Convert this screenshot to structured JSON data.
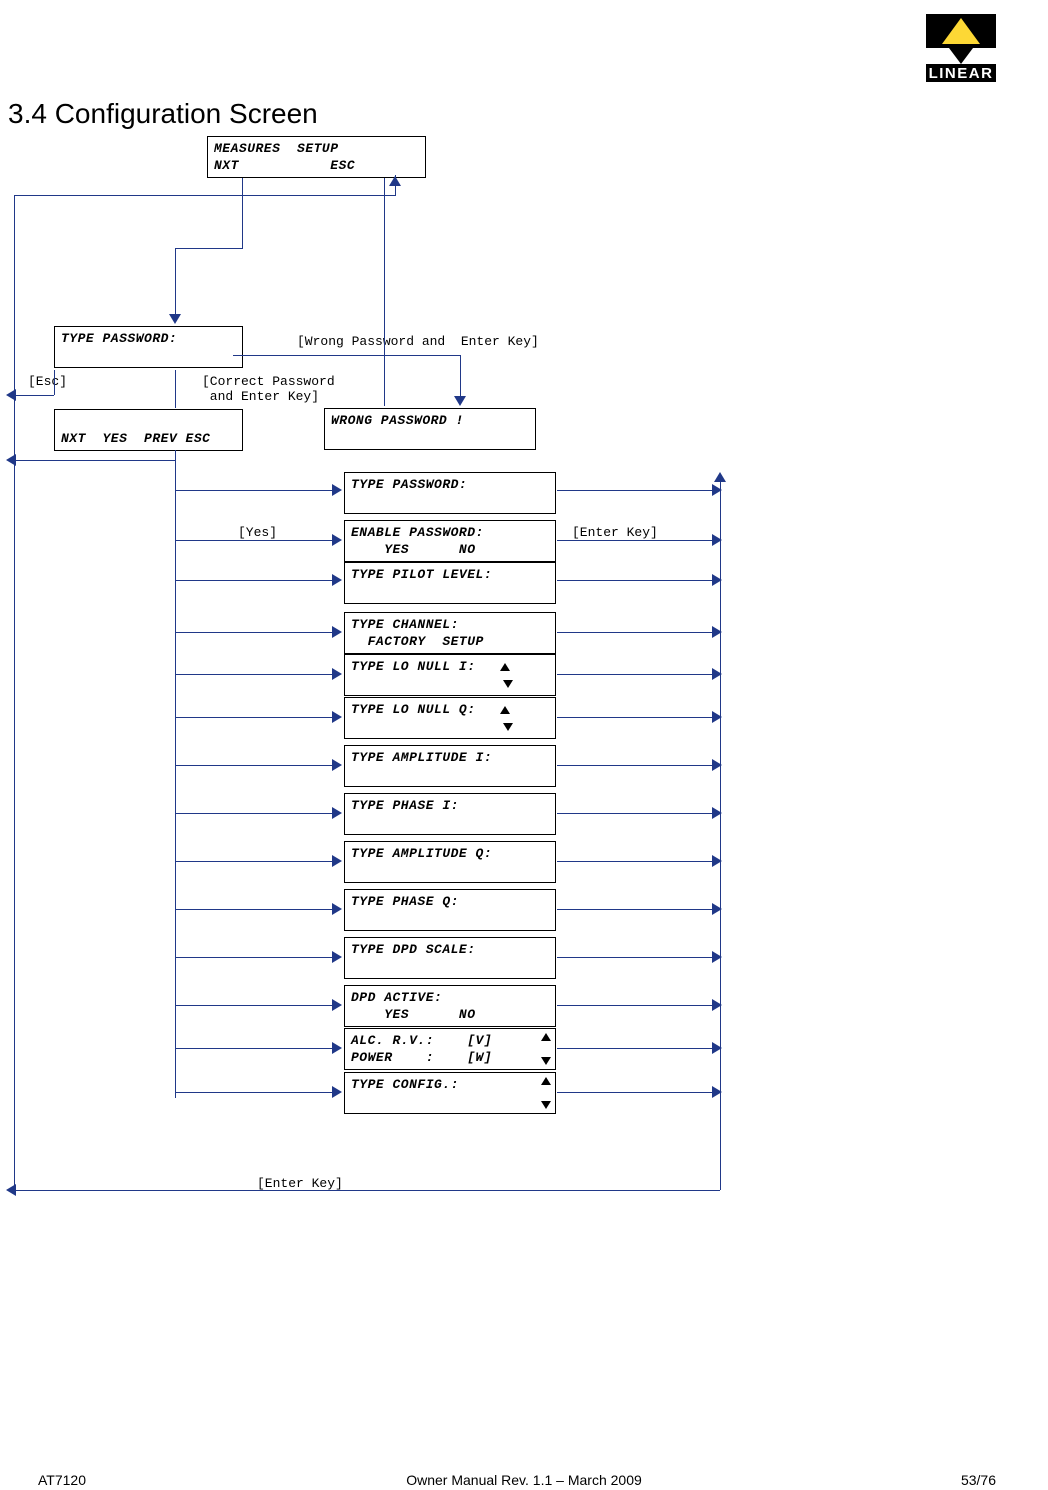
{
  "logo_text": "LINEAR",
  "heading": "3.4 Configuration Screen",
  "boxes": {
    "measures_setup": "MEASURES  SETUP\nNXT           ESC",
    "type_password_top": "TYPE PASSWORD:\n ",
    "nxt_yes_prev_esc": "\nNXT  YES  PREV ESC",
    "wrong_password": "WRONG PASSWORD !\n ",
    "type_password": "TYPE PASSWORD:\n ",
    "enable_password": "ENABLE PASSWORD:\n    YES      NO",
    "type_pilot_level": "TYPE PILOT LEVEL:\n ",
    "type_channel": "TYPE CHANNEL:\n  FACTORY  SETUP",
    "type_lo_null_i": "TYPE LO NULL I:   ",
    "type_lo_null_q": "TYPE LO NULL Q:   ",
    "type_amplitude_i": "TYPE AMPLITUDE I:\n ",
    "type_phase_i": "TYPE PHASE I:\n ",
    "type_amplitude_q": "TYPE AMPLITUDE Q:\n ",
    "type_phase_q": "TYPE PHASE Q:\n ",
    "type_dpd_scale": "TYPE DPD SCALE:\n ",
    "dpd_active": "DPD ACTIVE:\n    YES      NO",
    "alc_rv": "ALC. R.V.:    [V]\nPOWER    :    [W]",
    "type_config": "TYPE CONFIG.:    \n "
  },
  "labels": {
    "wrong_pw_enter": "[Wrong Password and  Enter Key]",
    "esc": "[Esc]",
    "correct_pw": "[Correct Password\n and Enter Key]",
    "yes": "[Yes]",
    "enter_key": "[Enter Key]",
    "enter_key_bottom": "[Enter Key]"
  },
  "footer": {
    "left": "AT7120",
    "center": "Owner Manual Rev. 1.1 – March 2009",
    "right": "53/76"
  }
}
